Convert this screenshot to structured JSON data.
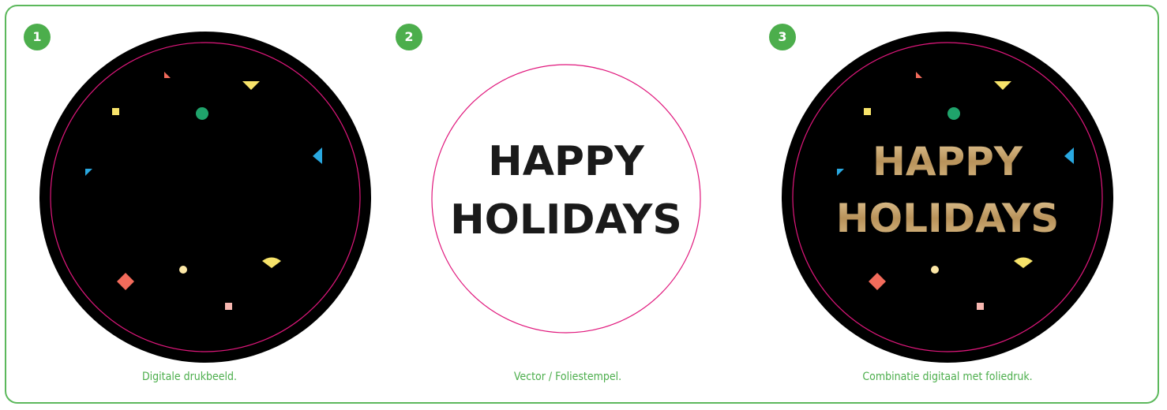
{
  "colors": {
    "frame": "#5cb85c",
    "badge": "#4cae4c",
    "caption": "#4cae4c",
    "cut_line": "#e0177c",
    "label_black": "#000000",
    "foil_gold": "#c9a66b",
    "confetti_salmon": "#f26b5b",
    "confetti_yellow": "#f7e36a",
    "confetti_green": "#1fa36b",
    "confetti_cyan": "#29a8e0",
    "confetti_cream": "#fce7a6",
    "confetti_pink": "#f7b7b0"
  },
  "panels": [
    {
      "number": "1",
      "caption": "Digitale drukbeeld."
    },
    {
      "number": "2",
      "caption": "Vector / Foliestempel."
    },
    {
      "number": "3",
      "caption": "Combinatie digitaal met foliedruk."
    }
  ],
  "headline": {
    "line1": "HAPPY",
    "line2": "HOLIDAYS"
  }
}
